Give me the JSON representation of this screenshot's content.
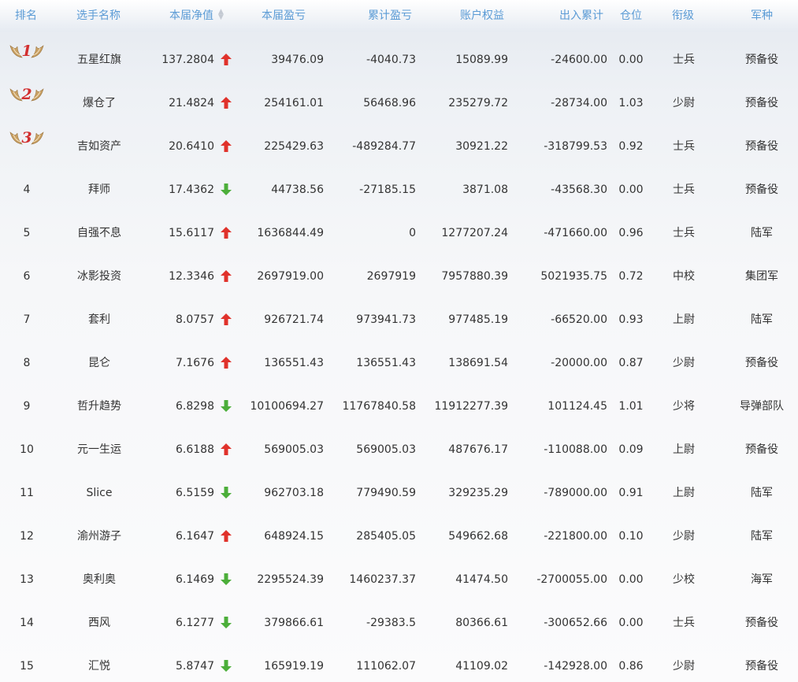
{
  "header": {
    "rank": "排名",
    "name": "选手名称",
    "nav": "本届净值",
    "profit": "本届盈亏",
    "cum_profit": "累计盈亏",
    "equity": "账户权益",
    "flow": "出入累计",
    "position": "仓位",
    "title": "衔级",
    "branch": "军种",
    "sort_icon": "sort-icon"
  },
  "colors": {
    "header_text": "#5b9bd5",
    "up": "#e0322b",
    "down": "#4cae3a",
    "badge_gold": "#c9a165",
    "badge_red": "#d22f2f"
  },
  "rows": [
    {
      "rank": "1",
      "name": "五星红旗",
      "nav": "137.2804",
      "trend": "up",
      "profit": "39476.09",
      "cum_profit": "-4040.73",
      "equity": "15089.99",
      "flow": "-24600.00",
      "position": "0.00",
      "title": "士兵",
      "branch": "预备役"
    },
    {
      "rank": "2",
      "name": "爆仓了",
      "nav": "21.4824",
      "trend": "up",
      "profit": "254161.01",
      "cum_profit": "56468.96",
      "equity": "235279.72",
      "flow": "-28734.00",
      "position": "1.03",
      "title": "少尉",
      "branch": "预备役"
    },
    {
      "rank": "3",
      "name": "吉如资产",
      "nav": "20.6410",
      "trend": "up",
      "profit": "225429.63",
      "cum_profit": "-489284.77",
      "equity": "30921.22",
      "flow": "-318799.53",
      "position": "0.92",
      "title": "士兵",
      "branch": "预备役"
    },
    {
      "rank": "4",
      "name": "拜师",
      "nav": "17.4362",
      "trend": "down",
      "profit": "44738.56",
      "cum_profit": "-27185.15",
      "equity": "3871.08",
      "flow": "-43568.30",
      "position": "0.00",
      "title": "士兵",
      "branch": "预备役"
    },
    {
      "rank": "5",
      "name": "自强不息",
      "nav": "15.6117",
      "trend": "up",
      "profit": "1636844.49",
      "cum_profit": "0",
      "equity": "1277207.24",
      "flow": "-471660.00",
      "position": "0.96",
      "title": "士兵",
      "branch": "陆军"
    },
    {
      "rank": "6",
      "name": "冰影投资",
      "nav": "12.3346",
      "trend": "up",
      "profit": "2697919.00",
      "cum_profit": "2697919",
      "equity": "7957880.39",
      "flow": "5021935.75",
      "position": "0.72",
      "title": "中校",
      "branch": "集团军"
    },
    {
      "rank": "7",
      "name": "套利",
      "nav": "8.0757",
      "trend": "up",
      "profit": "926721.74",
      "cum_profit": "973941.73",
      "equity": "977485.19",
      "flow": "-66520.00",
      "position": "0.93",
      "title": "上尉",
      "branch": "陆军"
    },
    {
      "rank": "8",
      "name": "昆仑",
      "nav": "7.1676",
      "trend": "up",
      "profit": "136551.43",
      "cum_profit": "136551.43",
      "equity": "138691.54",
      "flow": "-20000.00",
      "position": "0.87",
      "title": "少尉",
      "branch": "预备役"
    },
    {
      "rank": "9",
      "name": "哲升趋势",
      "nav": "6.8298",
      "trend": "down",
      "profit": "10100694.27",
      "cum_profit": "11767840.58",
      "equity": "11912277.39",
      "flow": "101124.45",
      "position": "1.01",
      "title": "少将",
      "branch": "导弹部队"
    },
    {
      "rank": "10",
      "name": "元一生运",
      "nav": "6.6188",
      "trend": "up",
      "profit": "569005.03",
      "cum_profit": "569005.03",
      "equity": "487676.17",
      "flow": "-110088.00",
      "position": "0.09",
      "title": "上尉",
      "branch": "预备役"
    },
    {
      "rank": "11",
      "name": "Slice",
      "nav": "6.5159",
      "trend": "down",
      "profit": "962703.18",
      "cum_profit": "779490.59",
      "equity": "329235.29",
      "flow": "-789000.00",
      "position": "0.91",
      "title": "上尉",
      "branch": "陆军"
    },
    {
      "rank": "12",
      "name": "渝州游子",
      "nav": "6.1647",
      "trend": "up",
      "profit": "648924.15",
      "cum_profit": "285405.05",
      "equity": "549662.68",
      "flow": "-221800.00",
      "position": "0.10",
      "title": "少尉",
      "branch": "陆军"
    },
    {
      "rank": "13",
      "name": "奥利奥",
      "nav": "6.1469",
      "trend": "down",
      "profit": "2295524.39",
      "cum_profit": "1460237.37",
      "equity": "41474.50",
      "flow": "-2700055.00",
      "position": "0.00",
      "title": "少校",
      "branch": "海军"
    },
    {
      "rank": "14",
      "name": "西风",
      "nav": "6.1277",
      "trend": "down",
      "profit": "379866.61",
      "cum_profit": "-29383.5",
      "equity": "80366.61",
      "flow": "-300652.66",
      "position": "0.00",
      "title": "士兵",
      "branch": "预备役"
    },
    {
      "rank": "15",
      "name": "汇悦",
      "nav": "5.8747",
      "trend": "down",
      "profit": "165919.19",
      "cum_profit": "111062.07",
      "equity": "41109.02",
      "flow": "-142928.00",
      "position": "0.86",
      "title": "少尉",
      "branch": "预备役"
    }
  ]
}
